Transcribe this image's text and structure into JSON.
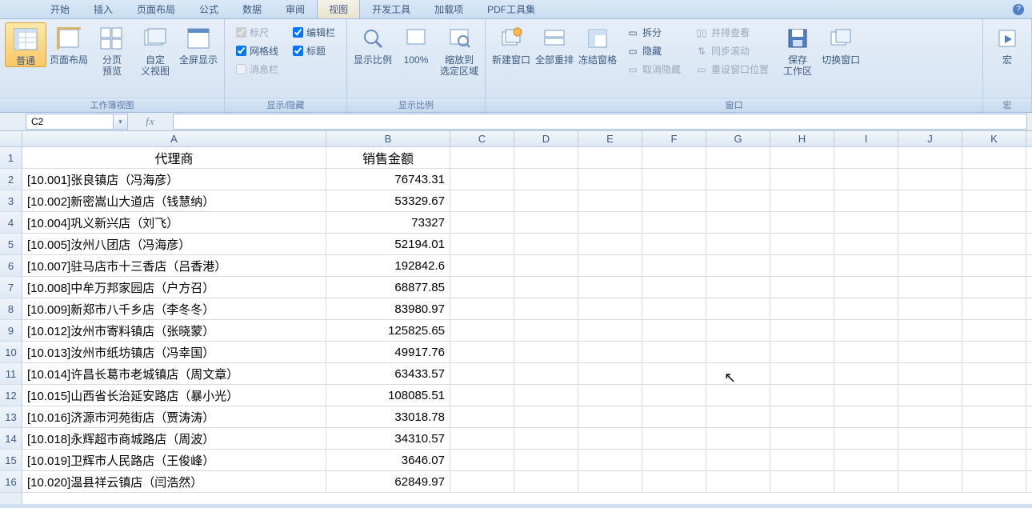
{
  "tabs": [
    "开始",
    "插入",
    "页面布局",
    "公式",
    "数据",
    "审阅",
    "视图",
    "开发工具",
    "加载项",
    "PDF工具集"
  ],
  "active_tab": "视图",
  "ribbon": {
    "views": {
      "label": "工作簿视图",
      "items": [
        {
          "lbl": "普通",
          "sel": true
        },
        {
          "lbl": "页面布局"
        },
        {
          "lbl": "分页\n预览"
        },
        {
          "lbl": "自定\n义视图"
        },
        {
          "lbl": "全屏显示"
        }
      ]
    },
    "showhide": {
      "label": "显示/隐藏",
      "ruler": "标尺",
      "grid": "网格线",
      "msgbar": "消息栏",
      "formula": "编辑栏",
      "heading": "标题"
    },
    "zoom": {
      "label": "显示比例",
      "zoom": "显示比例",
      "z100": "100%",
      "zsel": "缩放到\n选定区域"
    },
    "window": {
      "label": "窗口",
      "neww": "新建窗口",
      "arr": "全部重排",
      "freeze": "冻结窗格",
      "split": "拆分",
      "hide": "隐藏",
      "unhide": "取消隐藏",
      "side": "并排查看",
      "sync": "同步滚动",
      "reset": "重设窗口位置",
      "save": "保存\n工作区",
      "switch": "切换窗口"
    },
    "macro": {
      "label": "宏",
      "lbl": "宏"
    }
  },
  "namebox": "C2",
  "columns": [
    "A",
    "B",
    "C",
    "D",
    "E",
    "F",
    "G",
    "H",
    "I",
    "J",
    "K"
  ],
  "rownums": [
    "1",
    "2",
    "3",
    "4",
    "5",
    "6",
    "7",
    "8",
    "9",
    "10",
    "11",
    "12",
    "13",
    "14",
    "15",
    "16"
  ],
  "headers": {
    "A": "代理商",
    "B": "销售金额"
  },
  "rows": [
    {
      "A": "[10.001]张良镇店（冯海彦）",
      "B": "76743.31"
    },
    {
      "A": "[10.002]新密嵩山大道店（钱慧纳）",
      "B": "53329.67"
    },
    {
      "A": "[10.004]巩义新兴店（刘飞）",
      "B": "73327"
    },
    {
      "A": "[10.005]汝州八团店（冯海彦）",
      "B": "52194.01"
    },
    {
      "A": "[10.007]驻马店市十三香店（吕香港）",
      "B": "192842.6"
    },
    {
      "A": "[10.008]中牟万邦家园店（户方召）",
      "B": "68877.85"
    },
    {
      "A": "[10.009]新郑市八千乡店（李冬冬）",
      "B": "83980.97"
    },
    {
      "A": "[10.012]汝州市寄料镇店（张晓蒙）",
      "B": "125825.65"
    },
    {
      "A": "[10.013]汝州市纸坊镇店（冯幸国）",
      "B": "49917.76"
    },
    {
      "A": "[10.014]许昌长葛市老城镇店（周文章）",
      "B": "63433.57"
    },
    {
      "A": "[10.015]山西省长治延安路店（暴小光）",
      "B": "108085.51"
    },
    {
      "A": "[10.016]济源市河苑街店（贾涛涛）",
      "B": "33018.78"
    },
    {
      "A": "[10.018]永辉超市商城路店（周波）",
      "B": "34310.57"
    },
    {
      "A": "[10.019]卫辉市人民路店（王俊峰）",
      "B": "3646.07"
    },
    {
      "A": "[10.020]温县祥云镇店（闫浩然）",
      "B": "62849.97"
    }
  ]
}
